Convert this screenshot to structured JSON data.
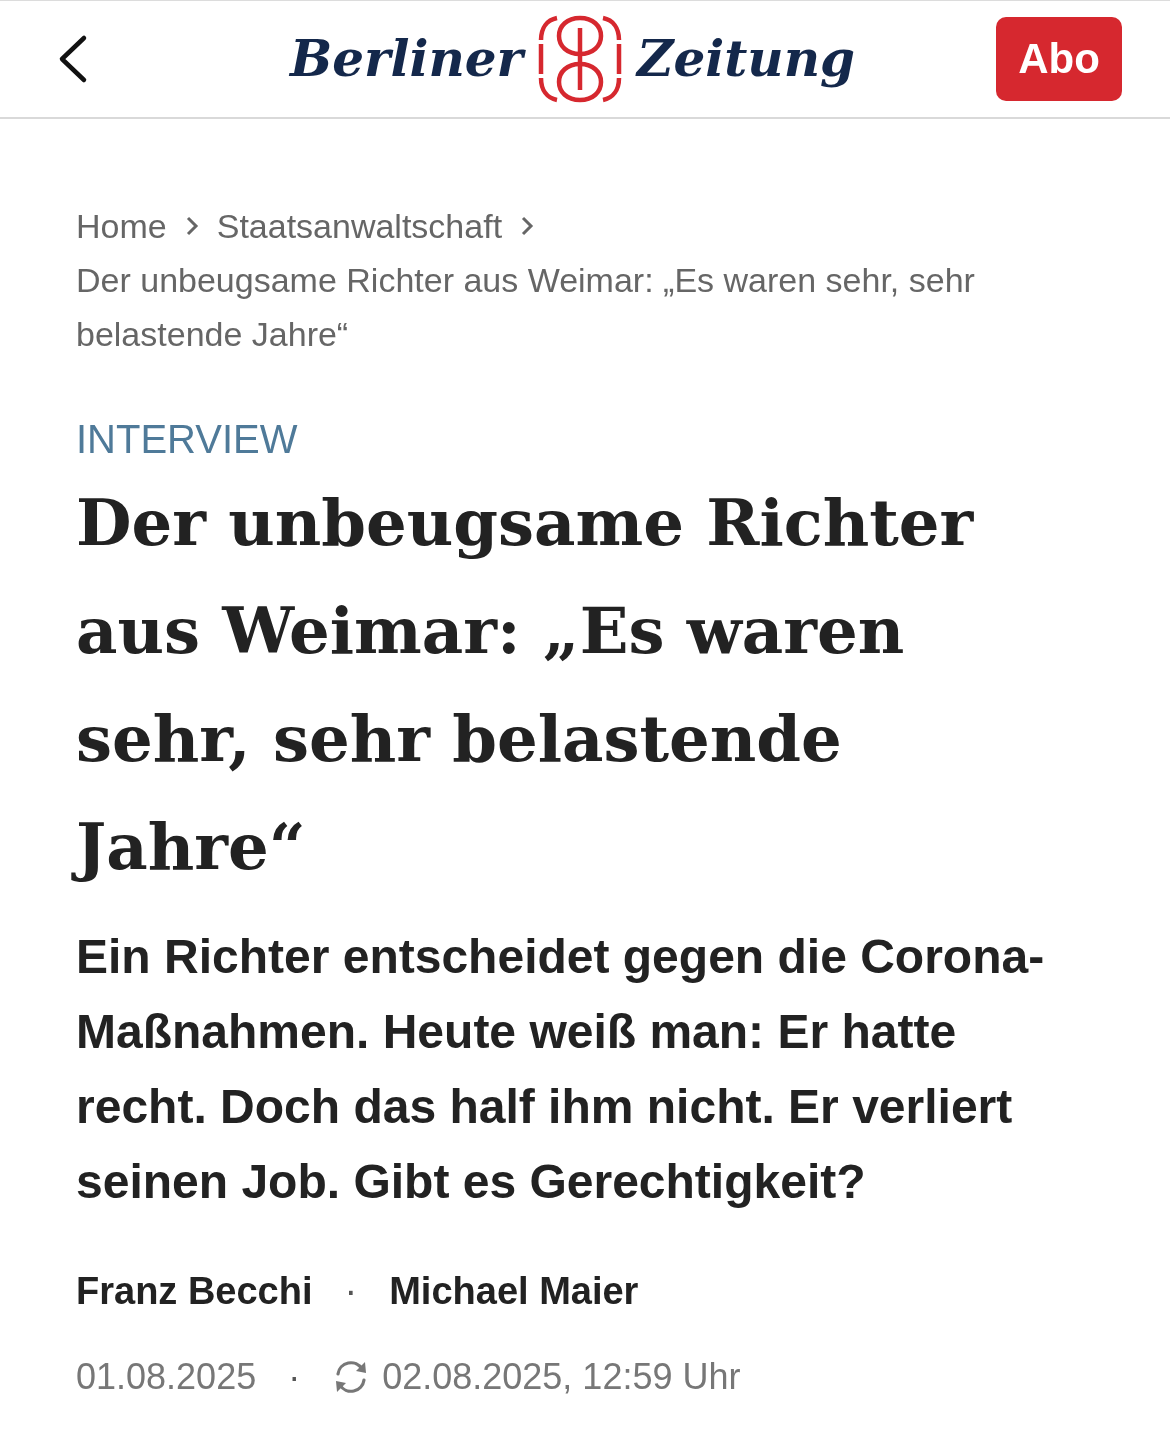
{
  "header": {
    "logo": {
      "left": "Berliner",
      "right": "Zeitung"
    },
    "subscribe_button": "Abo"
  },
  "breadcrumbs": {
    "items": [
      "Home",
      "Staatsanwaltschaft"
    ],
    "current": "Der unbeugsame Richter aus Weimar: „Es waren sehr, sehr belastende Jahre“"
  },
  "article": {
    "kicker": "INTERVIEW",
    "title": "Der unbeugsame Richter aus Weimar: „Es waren sehr, sehr belastende Jahre“",
    "lede": "Ein Richter entscheidet gegen die Corona-Maßnahmen. Heute weiß man: Er hatte recht. Doch das half ihm nicht. Er verliert seinen Job. Gibt es Gerechtigkeit?",
    "authors": [
      "Franz Becchi",
      "Michael Maier"
    ],
    "author_separator": "·",
    "published": "01.08.2025",
    "date_separator": "·",
    "updated": "02.08.2025, 12:59 Uhr"
  }
}
